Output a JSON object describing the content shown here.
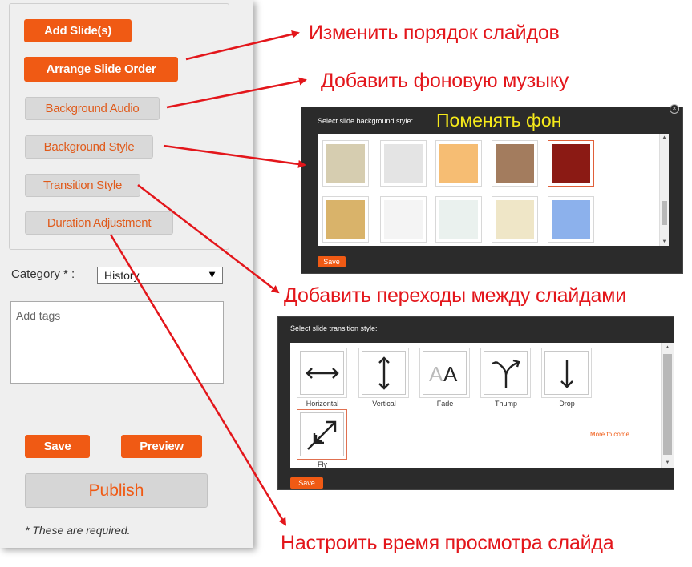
{
  "panel": {
    "buttons": {
      "add_slides": "Add Slide(s)",
      "arrange": "Arrange Slide Order",
      "background_audio": "Background Audio",
      "background_style": "Background Style",
      "transition_style": "Transition Style",
      "duration": "Duration Adjustment"
    },
    "category_label": "Category * :",
    "category_value": "History",
    "tags_placeholder": "Add tags",
    "save": "Save",
    "preview": "Preview",
    "publish": "Publish",
    "required_note": "* These are required."
  },
  "annotations": {
    "arrange": "Изменить порядок слайдов",
    "audio": "Добавить фоновую музыку",
    "background": "Поменять фон",
    "transitions": "Добавить переходы между слайдами",
    "duration": "Настроить время просмотра слайда"
  },
  "background_dialog": {
    "title": "Select slide background style:",
    "save": "Save",
    "swatches": [
      "#d6cdb0",
      "#e4e4e4",
      "#f6bd73",
      "#a37c5e",
      "#8b1a14",
      "#d9b36a",
      "#f4f4f4",
      "#eaf1ee",
      "#efe6c7",
      "#8cb1ec"
    ],
    "selected_index": 4
  },
  "transition_dialog": {
    "title": "Select slide transition style:",
    "items": [
      {
        "label": "Horizontal",
        "icon": "horizontal-arrows-icon"
      },
      {
        "label": "Vertical",
        "icon": "vertical-arrows-icon"
      },
      {
        "label": "Fade",
        "icon": "fade-aa-icon"
      },
      {
        "label": "Thump",
        "icon": "thump-icon"
      },
      {
        "label": "Drop",
        "icon": "down-arrow-icon"
      },
      {
        "label": "Fly",
        "icon": "fly-arrow-icon"
      }
    ],
    "selected_index": 5,
    "more": "More to come ...",
    "save": "Save"
  },
  "colors": {
    "accent": "#f05a14",
    "annotation": "#e3161b",
    "highlight": "#f6ea1a"
  }
}
